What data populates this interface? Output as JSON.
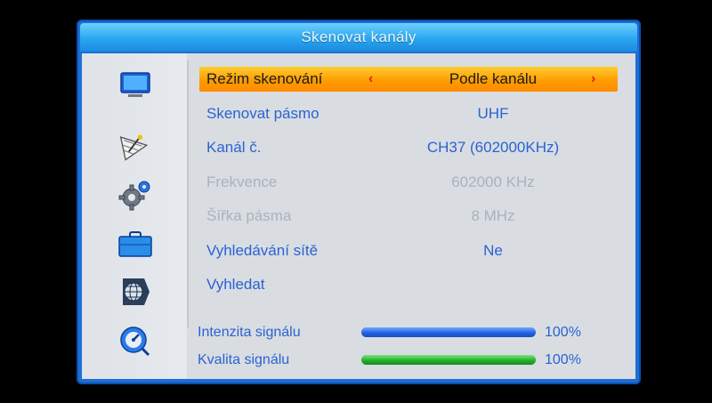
{
  "window": {
    "title": "Skenovat kanály"
  },
  "sidebar": {
    "icons": [
      {
        "name": "tv-icon"
      },
      {
        "name": "satellite-dish-icon"
      },
      {
        "name": "gear-icon"
      },
      {
        "name": "briefcase-icon"
      },
      {
        "name": "globe-icon"
      },
      {
        "name": "dial-icon"
      }
    ]
  },
  "menu": {
    "rows": [
      {
        "label": "Režim skenování",
        "value": "Podle kanálu"
      },
      {
        "label": "Skenovat pásmo",
        "value": "UHF"
      },
      {
        "label": "Kanál č.",
        "value": "CH37 (602000KHz)"
      },
      {
        "label": "Frekvence",
        "value": "602000 KHz"
      },
      {
        "label": "Šířka pásma",
        "value": "8 MHz"
      },
      {
        "label": "Vyhledávání sítě",
        "value": "Ne"
      },
      {
        "label": "Vyhledat",
        "value": ""
      }
    ],
    "arrows": {
      "left": "‹",
      "right": "›"
    }
  },
  "signal": {
    "intensity": {
      "label": "Intenzita signálu",
      "percent_text": "100%",
      "level": 100
    },
    "quality": {
      "label": "Kvalita signálu",
      "percent_text": "100%",
      "level": 100
    }
  },
  "colors": {
    "accent": "#1c6fd6",
    "selection": "#ff9d00",
    "text": "#2a62d2",
    "disabled_text": "#a9b2bd"
  }
}
